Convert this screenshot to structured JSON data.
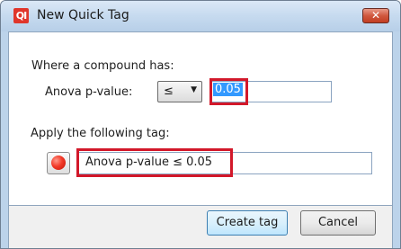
{
  "window": {
    "app_icon_text": "QI",
    "title": "New Quick Tag",
    "close_glyph": "✕"
  },
  "condition": {
    "heading": "Where a compound has:",
    "field_label": "Anova p-value:",
    "operator": "≤",
    "dropdown_arrow": "▼",
    "value": "0.05"
  },
  "tag": {
    "heading": "Apply the following tag:",
    "color": "#e8271a",
    "name": "Anova p-value ≤ 0.05"
  },
  "buttons": {
    "create_label": "Create tag",
    "cancel_label": "Cancel"
  },
  "colors": {
    "highlight": "#d2182a",
    "title_bar": "#c6daef"
  }
}
